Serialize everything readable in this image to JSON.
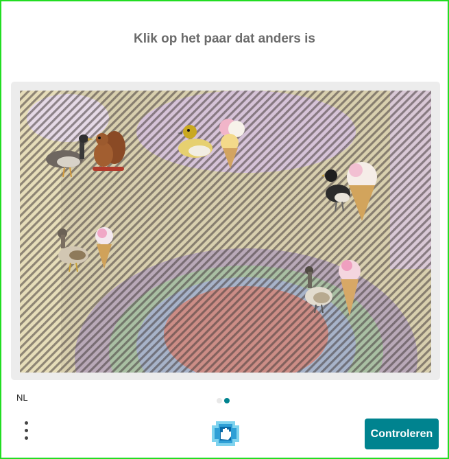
{
  "challenge": {
    "prompt": "Klik op het paar dat anders is"
  },
  "footer": {
    "language": "NL",
    "submit_label": "Controleren",
    "menu_icon": "more-vertical-icon",
    "logo_icon": "hand-logo-icon",
    "pagination": {
      "total": 2,
      "active": 2
    }
  },
  "colors": {
    "border": "#22dd22",
    "title": "#6b6b6b",
    "button": "#00838f",
    "dot_active": "#00838f",
    "dot_inactive": "#e8e8e8"
  },
  "pairs": [
    {
      "left": "goose",
      "right": "squirrel-on-branch"
    },
    {
      "left": "duckling",
      "right": "ice-cream-cones"
    },
    {
      "left": "duck",
      "right": "ice-cream-cone"
    },
    {
      "left": "duck",
      "right": "ice-cream-cone"
    },
    {
      "left": "duck",
      "right": "ice-cream-cone"
    }
  ]
}
